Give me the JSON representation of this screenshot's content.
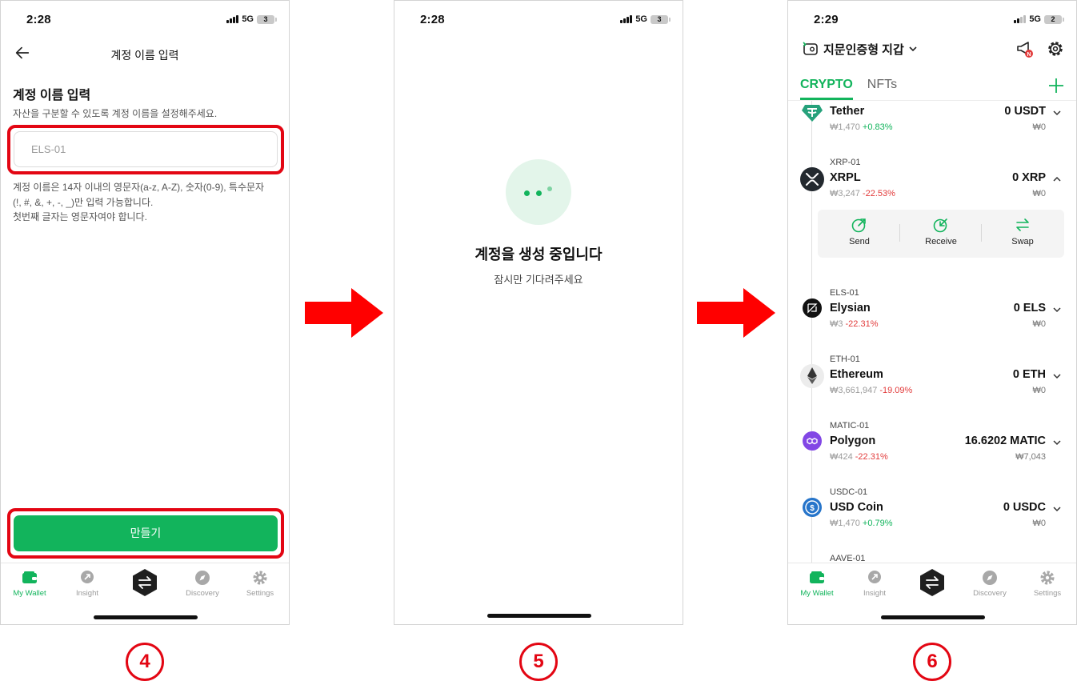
{
  "steps": [
    {
      "number": "4",
      "status": {
        "time": "2:28",
        "network": "5G",
        "battery": "3"
      },
      "header_title": "계정 이름 입력",
      "title": "계정 이름 입력",
      "subtitle": "자산을 구분할 수 있도록 계정 이름을 설정해주세요.",
      "input_placeholder": "ELS-01",
      "help_line1": "계정 이름은 14자 이내의 영문자(a-z, A-Z), 숫자(0-9), 특수문자",
      "help_line2": "(!, #, &, +, -, _)만 입력 가능합니다.",
      "help_line3": "첫번째 글자는 영문자여야 합니다.",
      "button_label": "만들기",
      "highlight_color": "#e30613"
    },
    {
      "number": "5",
      "status": {
        "time": "2:28",
        "network": "5G",
        "battery": "3"
      },
      "title": "계정을 생성 중입니다",
      "subtitle": "잠시만 기다려주세요"
    },
    {
      "number": "6",
      "status": {
        "time": "2:29",
        "network": "5G",
        "battery": "2"
      },
      "wallet_name": "지문인증형 지갑",
      "tabs": [
        "CRYPTO",
        "NFTs"
      ],
      "accent_color": "#12b45c",
      "assets": [
        {
          "id": "",
          "name": "Tether",
          "price": "₩1,470",
          "change": "+0.83%",
          "balance": "0 USDT",
          "fiat": "₩0",
          "icon": "tether-icon"
        },
        {
          "id": "XRP-01",
          "name": "XRPL",
          "price": "₩3,247",
          "change": "-22.53%",
          "balance": "0 XRP",
          "fiat": "₩0",
          "icon": "xrp-icon"
        },
        {
          "id": "ELS-01",
          "name": "Elysian",
          "price": "₩3",
          "change": "-22.31%",
          "balance": "0 ELS",
          "fiat": "₩0",
          "icon": "elysian-icon"
        },
        {
          "id": "ETH-01",
          "name": "Ethereum",
          "price": "₩3,661,947",
          "change": "-19.09%",
          "balance": "0 ETH",
          "fiat": "₩0",
          "icon": "ethereum-icon"
        },
        {
          "id": "MATIC-01",
          "name": "Polygon",
          "price": "₩424",
          "change": "-22.31%",
          "balance": "16.6202 MATIC",
          "fiat": "₩7,043",
          "icon": "polygon-icon"
        },
        {
          "id": "USDC-01",
          "name": "USD Coin",
          "price": "₩1,470",
          "change": "+0.79%",
          "balance": "0 USDC",
          "fiat": "₩0",
          "icon": "usdc-icon"
        },
        {
          "id": "AAVE-01"
        }
      ],
      "actions": [
        "Send",
        "Receive",
        "Swap"
      ]
    }
  ],
  "tabbar": [
    "My Wallet",
    "Insight",
    "Discovery",
    "Settings"
  ]
}
